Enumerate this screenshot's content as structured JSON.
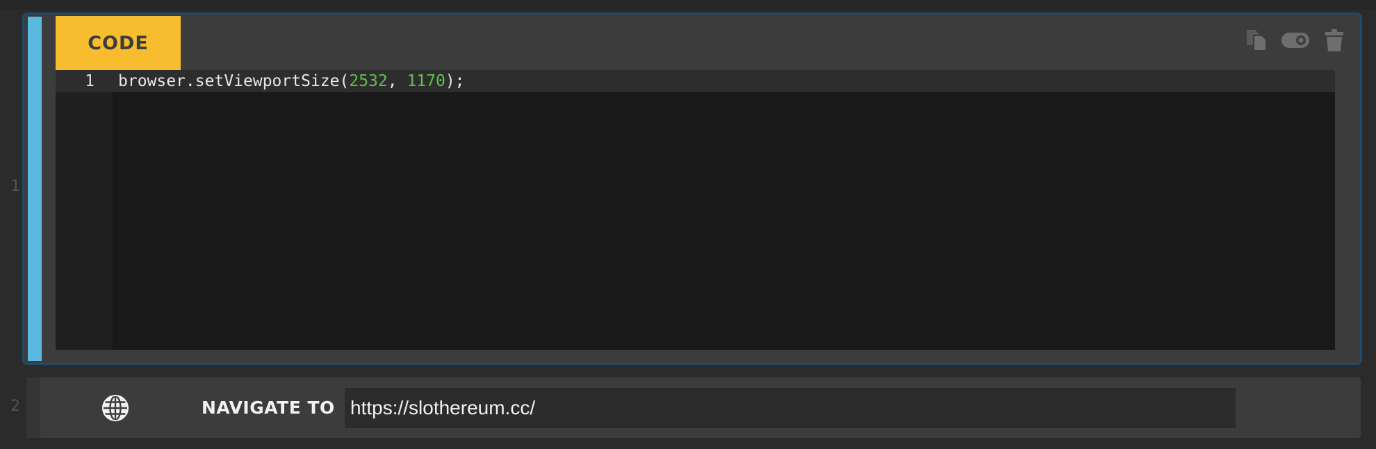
{
  "steps": [
    {
      "number": "1",
      "type_label": "CODE",
      "toolbar": {
        "copy_icon": "copy-icon",
        "toggle_icon": "toggle-icon",
        "delete_icon": "trash-icon"
      },
      "editor": {
        "lines": [
          {
            "number": "1",
            "tokens": [
              {
                "text": "browser.setViewportSize(",
                "kind": "plain"
              },
              {
                "text": "2532",
                "kind": "number"
              },
              {
                "text": ", ",
                "kind": "plain"
              },
              {
                "text": "1170",
                "kind": "number"
              },
              {
                "text": ");",
                "kind": "plain"
              }
            ]
          }
        ]
      }
    },
    {
      "number": "2",
      "icon": "globe-icon",
      "label": "NAVIGATE TO",
      "url": "https://slothereum.cc/"
    }
  ],
  "colors": {
    "badge": "#f8bc2f",
    "accent": "#5ab9de",
    "number_token": "#5fc14a"
  }
}
